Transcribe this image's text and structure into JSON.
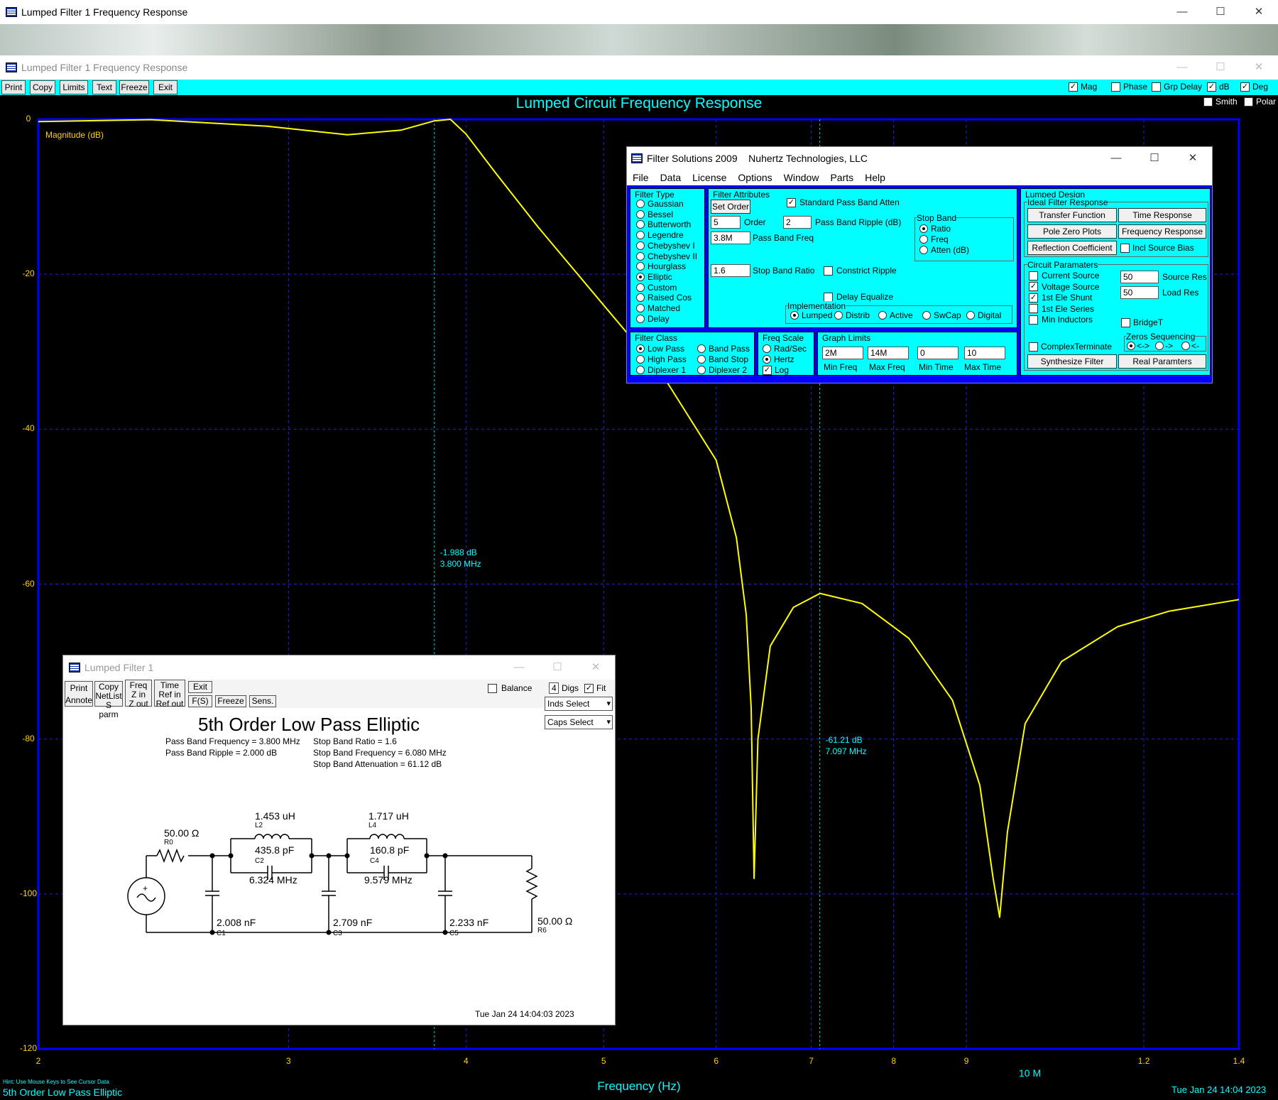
{
  "bg_window": {
    "title": "Lumped Filter 1 Frequency Response",
    "buttons": [
      "Print",
      "Copy",
      "Limits",
      "Text",
      "Freeze",
      "Exit"
    ],
    "checks": [
      {
        "label": "Mag",
        "checked": true
      },
      {
        "label": "Phase",
        "checked": false
      },
      {
        "label": "Grp Delay",
        "checked": false
      },
      {
        "label": "dB",
        "checked": true
      },
      {
        "label": "Deg",
        "checked": true
      }
    ]
  },
  "main_window": {
    "title": "Lumped Filter 1 Frequency Response",
    "toolbar": {
      "print": "Print",
      "copy": "Copy",
      "limits": "Limits",
      "text": "Text",
      "freeze": "Freeze",
      "exit": "Exit"
    },
    "checks": {
      "mag": "Mag",
      "phase": "Phase",
      "grp_delay": "Grp Delay",
      "db": "dB",
      "deg": "Deg",
      "smith": "Smith",
      "polar": "Polar"
    },
    "checked": {
      "mag": true,
      "phase": false,
      "grp_delay": false,
      "db": true,
      "deg": true,
      "smith": false,
      "polar": false
    }
  },
  "chart_data": {
    "type": "line",
    "title": "Lumped Circuit Frequency Response",
    "ylabel": "Magnitude (dB)",
    "xlabel": "Frequency (Hz)",
    "x_scale": "log",
    "xlim_mhz": [
      2,
      14
    ],
    "ylim": [
      -120,
      0
    ],
    "y_ticks": [
      "0",
      "-20",
      "-40",
      "-60",
      "-80",
      "-100",
      "-120"
    ],
    "x_ticks": [
      {
        "v": 2,
        "l": "2"
      },
      {
        "v": 3,
        "l": "3"
      },
      {
        "v": 4,
        "l": "4"
      },
      {
        "v": 5,
        "l": "5"
      },
      {
        "v": 6,
        "l": "6"
      },
      {
        "v": 7,
        "l": "7"
      },
      {
        "v": 8,
        "l": "8"
      },
      {
        "v": 9,
        "l": "9"
      },
      {
        "v": 12,
        "l": "1.2"
      },
      {
        "v": 14,
        "l": "1.4"
      }
    ],
    "x_decade_label": "10 M",
    "grid": true,
    "series": [
      {
        "color": "#ffff00",
        "points": [
          [
            2,
            -0.3
          ],
          [
            2.4,
            -0.05
          ],
          [
            2.9,
            -0.9
          ],
          [
            3.3,
            -2.0
          ],
          [
            3.6,
            -1.4
          ],
          [
            3.8,
            -0.2
          ],
          [
            3.9,
            0
          ],
          [
            4.0,
            -1.9
          ],
          [
            4.2,
            -7
          ],
          [
            4.5,
            -14
          ],
          [
            5.0,
            -24
          ],
          [
            5.5,
            -33
          ],
          [
            6.0,
            -44
          ],
          [
            6.2,
            -54
          ],
          [
            6.3,
            -64
          ],
          [
            6.35,
            -76
          ],
          [
            6.38,
            -98
          ],
          [
            6.42,
            -80
          ],
          [
            6.55,
            -68
          ],
          [
            6.8,
            -63
          ],
          [
            7.1,
            -61.2
          ],
          [
            7.6,
            -62.5
          ],
          [
            8.2,
            -67
          ],
          [
            8.8,
            -75
          ],
          [
            9.2,
            -86
          ],
          [
            9.4,
            -98
          ],
          [
            9.5,
            -103
          ],
          [
            9.62,
            -92
          ],
          [
            9.9,
            -78
          ],
          [
            10.5,
            -70
          ],
          [
            11.5,
            -65.5
          ],
          [
            12.5,
            -63.5
          ],
          [
            14,
            -62
          ]
        ]
      }
    ],
    "markers": [
      {
        "x": 3.8,
        "db": "-1.988 dB",
        "freq": "3.800 MHz"
      },
      {
        "x": 7.097,
        "db": "-61.21 dB",
        "freq": "7.097 MHz"
      }
    ]
  },
  "footer": {
    "hint": "Hint: Use Mouse Keys to See Cursor Data",
    "name": "5th Order Low Pass Elliptic",
    "date": "Tue Jan 24 14:04 2023"
  },
  "fs": {
    "title": "Filter Solutions 2009    Nuhertz Technologies, LLC",
    "menu": [
      "File",
      "Data",
      "License",
      "Options",
      "Window",
      "Parts",
      "Help"
    ],
    "filter_type_label": "Filter Type",
    "filter_types": [
      "Gaussian",
      "Bessel",
      "Butterworth",
      "Legendre",
      "Chebyshev I",
      "Chebyshev II",
      "Hourglass",
      "Elliptic",
      "Custom",
      "Raised Cos",
      "Matched",
      "Delay"
    ],
    "filter_type_selected": 7,
    "attr_label": "Filter Attributes",
    "set_order": "Set Order",
    "order_val": "5",
    "order_lbl": "Order",
    "std_pb": "Standard Pass Band Atten",
    "ripple_val": "2",
    "ripple_lbl": "Pass Band Ripple (dB)",
    "pbf_val": "3.8M",
    "pbf_lbl": "Pass Band Freq",
    "sbr_val": "1.6",
    "sbr_lbl": "Stop Band Ratio",
    "constrict": "Constrict Ripple",
    "delay_eq": "Delay Equalize",
    "stop_band_label": "Stop Band",
    "stop_band": [
      "Ratio",
      "Freq",
      "Atten (dB)"
    ],
    "impl_label": "Implementation",
    "impl": [
      "Lumped",
      "Distrib",
      "Active",
      "SwCap",
      "Digital"
    ],
    "class_label": "Filter Class",
    "class": [
      "Low Pass",
      "High Pass",
      "Diplexer 1",
      "Band Pass",
      "Band Stop",
      "Diplexer 2"
    ],
    "fscale_label": "Freq Scale",
    "fscale": [
      "Rad/Sec",
      "Hertz",
      "Log"
    ],
    "glim_label": "Graph Limits",
    "glim_vals": [
      "2M",
      "14M",
      "0",
      "10"
    ],
    "glim_lbls": [
      "Min Freq",
      "Max Freq",
      "Min Time",
      "Max Time"
    ],
    "ld_label": "Lumped Design",
    "ideal_label": "Ideal Filter Response",
    "btns": [
      "Transfer Function",
      "Time Response",
      "Pole Zero Plots",
      "Frequency Response",
      "Reflection Coefficient"
    ],
    "incl_src": "Incl Source Bias",
    "circ_label": "Circuit Paramaters",
    "circ_checks": [
      {
        "l": "Current Source",
        "c": false
      },
      {
        "l": "Voltage Source",
        "c": true
      },
      {
        "l": "1st Ele Shunt",
        "c": true
      },
      {
        "l": "1st Ele Series",
        "c": false
      },
      {
        "l": "Min Inductors",
        "c": false
      }
    ],
    "src_val": "50",
    "src_lbl": "Source Res",
    "load_val": "50",
    "load_lbl": "Load Res",
    "bridget": "BridgeT",
    "complex": "ComplexTerminate",
    "zeros_label": "Zeros Sequencing",
    "zeros": [
      "<->",
      "->",
      "<-"
    ],
    "synth": "Synthesize Filter",
    "real": "Real Paramters"
  },
  "lf": {
    "title": "Lumped Filter 1",
    "b_print": "Print",
    "b_annote": "Annote",
    "b_copy": "Copy",
    "b_netlist": "NetList",
    "b_sparm": "S parm",
    "b_freq": "Freq",
    "b_zin": "Z in",
    "b_zout": "Z out",
    "b_time": "Time",
    "b_refin": "Ref in",
    "b_refout": "Ref out",
    "b_exit": "Exit",
    "b_fs": "F(S)",
    "b_freeze": "Freeze",
    "b_sens": "Sens.",
    "balance": "Balance",
    "digs_val": "4",
    "digs": "Digs",
    "fit": "Fit",
    "inds": "Inds Select",
    "caps": "Caps Select",
    "heading": "5th Order Low Pass Elliptic",
    "spec_left": [
      "Pass Band Frequency = 3.800 MHz",
      "Pass Band Ripple = 2.000 dB"
    ],
    "spec_right": [
      "Stop Band Ratio = 1.6",
      "Stop Band Frequency = 6.080 MHz",
      "Stop Band Attenuation = 61.12 dB"
    ],
    "comp": {
      "r0v": "50.00 Ω",
      "r0": "R0",
      "l2v": "1.453 uH",
      "l2": "L2",
      "c2v": "435.8 pF",
      "c2": "C2",
      "f2": "6.324 MHz",
      "l4v": "1.717 uH",
      "l4": "L4",
      "c4v": "160.8 pF",
      "c4": "C4",
      "f4": "9.579 MHz",
      "c1v": "2.008 nF",
      "c1": "C1",
      "c3v": "2.709 nF",
      "c3": "C3",
      "c5v": "2.233 nF",
      "c5": "C5",
      "r6v": "50.00 Ω",
      "r6": "R6"
    },
    "date": "Tue Jan 24 14:04:03 2023"
  }
}
